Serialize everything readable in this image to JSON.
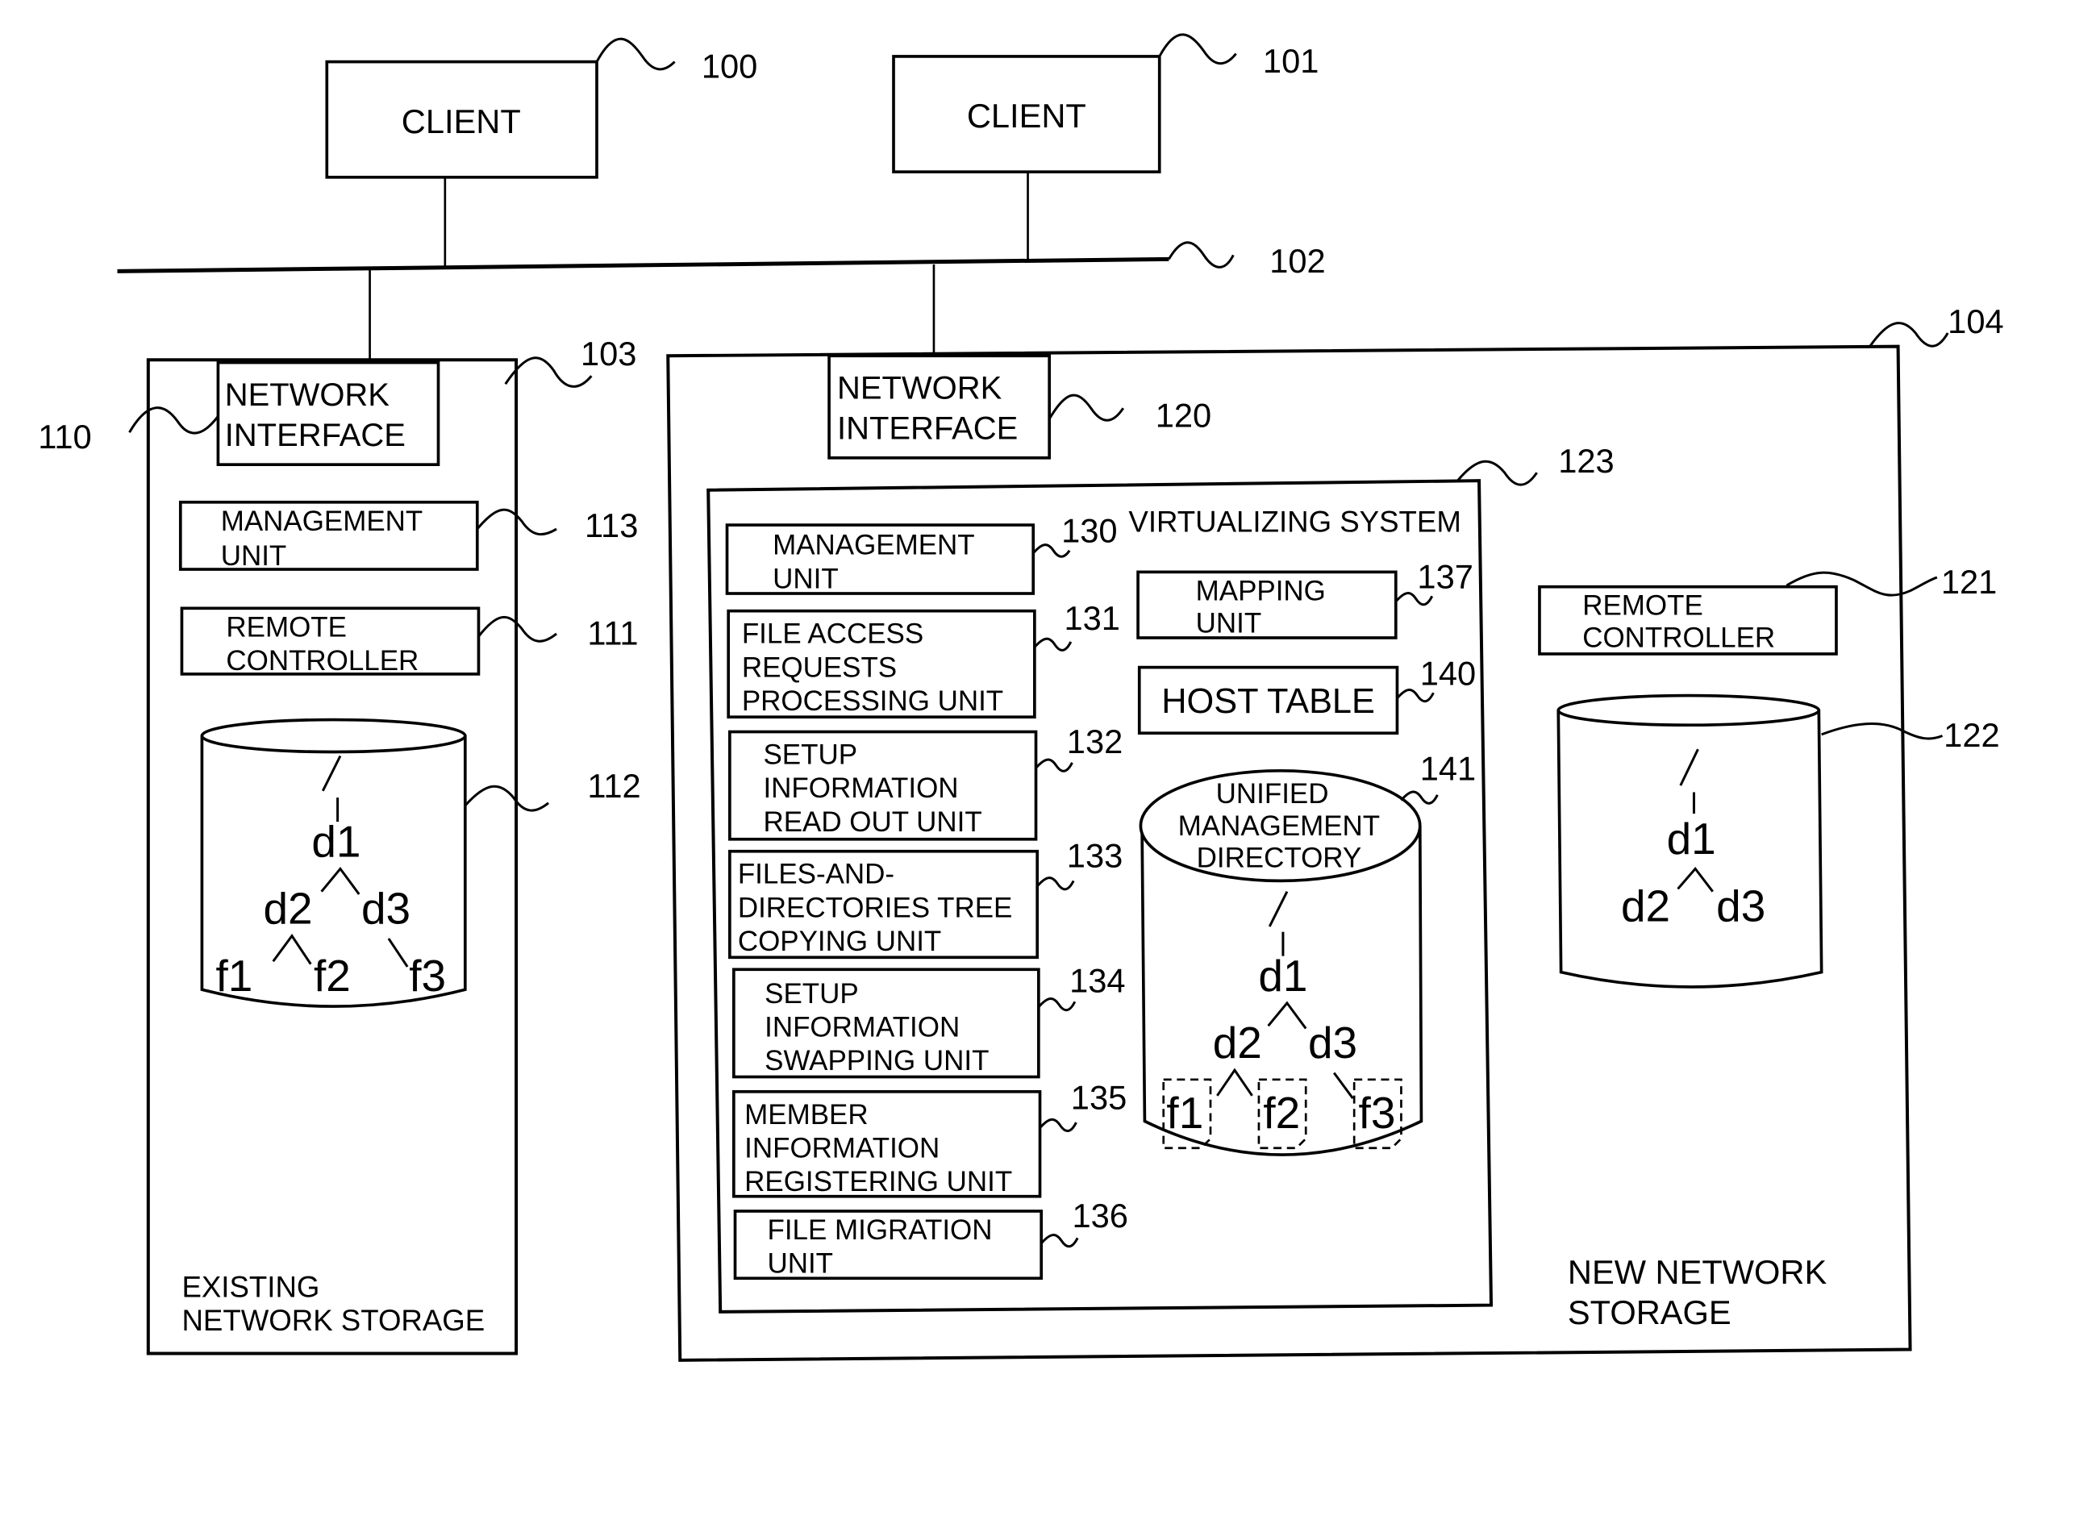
{
  "figure": {
    "clients": [
      {
        "ref": "100",
        "label": "CLIENT"
      },
      {
        "ref": "101",
        "label": "CLIENT"
      }
    ],
    "network": {
      "ref": "102"
    },
    "existing_storage": {
      "ref": "103",
      "title_lines": [
        "EXISTING",
        "NETWORK STORAGE"
      ],
      "network_interface": {
        "ref": "110",
        "lines": [
          "NETWORK",
          "INTERFACE"
        ]
      },
      "management_unit": {
        "ref": "113",
        "lines": [
          "MANAGEMENT",
          "UNIT"
        ]
      },
      "remote_controller": {
        "ref": "111",
        "lines": [
          "REMOTE",
          "CONTROLLER"
        ]
      },
      "volume": {
        "ref": "112",
        "root": "/",
        "tree": {
          "d1": "d1",
          "d2": "d2",
          "d3": "d3",
          "f1": "f1",
          "f2": "f2",
          "f3": "f3"
        }
      }
    },
    "new_storage": {
      "ref": "104",
      "title_lines": [
        "NEW NETWORK",
        "STORAGE"
      ],
      "network_interface": {
        "ref": "120",
        "lines": [
          "NETWORK",
          "INTERFACE"
        ]
      },
      "remote_controller": {
        "ref": "121",
        "lines": [
          "REMOTE",
          "CONTROLLER"
        ]
      },
      "volume": {
        "ref": "122",
        "root": "/",
        "tree": {
          "d1": "d1",
          "d2": "d2",
          "d3": "d3"
        }
      },
      "virtualizing_system": {
        "ref": "123",
        "title": "VIRTUALIZING SYSTEM",
        "units": [
          {
            "ref": "130",
            "lines": [
              "MANAGEMENT",
              "UNIT"
            ]
          },
          {
            "ref": "131",
            "lines": [
              "FILE ACCESS",
              "REQUESTS",
              "PROCESSING UNIT"
            ]
          },
          {
            "ref": "132",
            "lines": [
              "SETUP",
              "INFORMATION",
              "READ OUT UNIT"
            ]
          },
          {
            "ref": "133",
            "lines": [
              "FILES-AND-",
              "DIRECTORIES TREE",
              "COPYING UNIT"
            ]
          },
          {
            "ref": "134",
            "lines": [
              "SETUP",
              "INFORMATION",
              "SWAPPING UNIT"
            ]
          },
          {
            "ref": "135",
            "lines": [
              "MEMBER",
              "INFORMATION",
              "REGISTERING UNIT"
            ]
          },
          {
            "ref": "136",
            "lines": [
              "FILE MIGRATION",
              "UNIT"
            ]
          }
        ],
        "mapping_unit": {
          "ref": "137",
          "lines": [
            "MAPPING",
            "UNIT"
          ]
        },
        "host_table": {
          "ref": "140",
          "label": "HOST TABLE"
        },
        "unified_directory": {
          "ref": "141",
          "lines": [
            "UNIFIED",
            "MANAGEMENT",
            "DIRECTORY"
          ],
          "root": "/",
          "tree": {
            "d1": "d1",
            "d2": "d2",
            "d3": "d3",
            "f1": "f1",
            "f2": "f2",
            "f3": "f3"
          },
          "stub_files": true
        }
      }
    }
  }
}
